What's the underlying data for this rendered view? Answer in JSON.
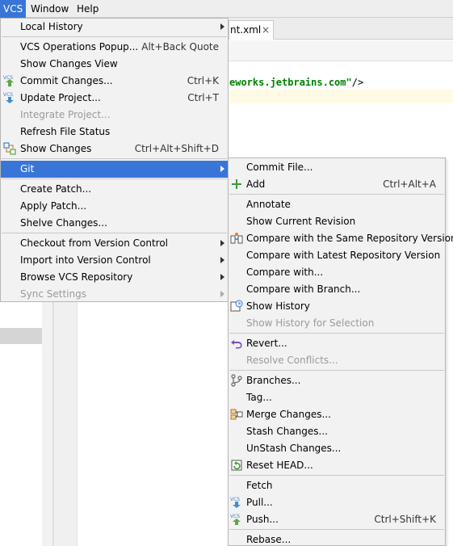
{
  "menubar": {
    "items": [
      "VCS",
      "Window",
      "Help"
    ]
  },
  "editor": {
    "tab_label": "nt.xml",
    "tab_close": "×",
    "code_prefix": "",
    "code_string": "eworks.jetbrains.com\"",
    "code_suffix": "/>"
  },
  "vcs_menu": {
    "items": [
      {
        "label": "Local History",
        "shortcut": "",
        "submenu": true,
        "disabled": false
      },
      {
        "label": "VCS Operations Popup...",
        "shortcut": "Alt+Back Quote",
        "disabled": false
      },
      {
        "label": "Show Changes View",
        "shortcut": "",
        "disabled": false
      },
      {
        "label": "Commit Changes...",
        "shortcut": "Ctrl+K",
        "icon": "commit-icon",
        "disabled": false
      },
      {
        "label": "Update Project...",
        "shortcut": "Ctrl+T",
        "icon": "update-icon",
        "disabled": false
      },
      {
        "label": "Integrate Project...",
        "shortcut": "",
        "disabled": true
      },
      {
        "label": "Refresh File Status",
        "shortcut": "",
        "disabled": false
      },
      {
        "label": "Show Changes",
        "shortcut": "Ctrl+Alt+Shift+D",
        "icon": "show-changes-icon",
        "disabled": false
      },
      {
        "label": "Git",
        "shortcut": "",
        "submenu": true,
        "selected": true
      },
      {
        "label": "Create Patch...",
        "shortcut": ""
      },
      {
        "label": "Apply Patch...",
        "shortcut": ""
      },
      {
        "label": "Shelve Changes...",
        "shortcut": ""
      },
      {
        "label": "Checkout from Version Control",
        "submenu": true
      },
      {
        "label": "Import into Version Control",
        "submenu": true
      },
      {
        "label": "Browse VCS Repository",
        "submenu": true
      },
      {
        "label": "Sync Settings",
        "submenu": true,
        "disabled": true
      }
    ]
  },
  "git_menu": {
    "items": [
      {
        "label": "Commit File...",
        "shortcut": ""
      },
      {
        "label": "Add",
        "shortcut": "Ctrl+Alt+A",
        "icon": "add-icon"
      },
      {
        "label": "Annotate",
        "shortcut": ""
      },
      {
        "label": "Show Current Revision",
        "shortcut": ""
      },
      {
        "label": "Compare with the Same Repository Version",
        "icon": "compare-icon"
      },
      {
        "label": "Compare with Latest Repository Version"
      },
      {
        "label": "Compare with..."
      },
      {
        "label": "Compare with Branch..."
      },
      {
        "label": "Show History",
        "icon": "history-icon"
      },
      {
        "label": "Show History for Selection",
        "disabled": true
      },
      {
        "label": "Revert...",
        "icon": "revert-icon"
      },
      {
        "label": "Resolve Conflicts...",
        "disabled": true
      },
      {
        "label": "Branches...",
        "icon": "branch-icon"
      },
      {
        "label": "Tag..."
      },
      {
        "label": "Merge Changes...",
        "icon": "merge-icon"
      },
      {
        "label": "Stash Changes..."
      },
      {
        "label": "UnStash Changes..."
      },
      {
        "label": "Reset HEAD...",
        "icon": "reset-icon"
      },
      {
        "label": "Fetch"
      },
      {
        "label": "Pull...",
        "icon": "pull-icon"
      },
      {
        "label": "Push...",
        "shortcut": "Ctrl+Shift+K",
        "icon": "push-icon"
      },
      {
        "label": "Rebase..."
      }
    ]
  },
  "colors": {
    "selection": "#3875d7",
    "menu_bg": "#f2f2f2",
    "disabled_text": "#9a9a9a",
    "string_green": "#008000"
  }
}
